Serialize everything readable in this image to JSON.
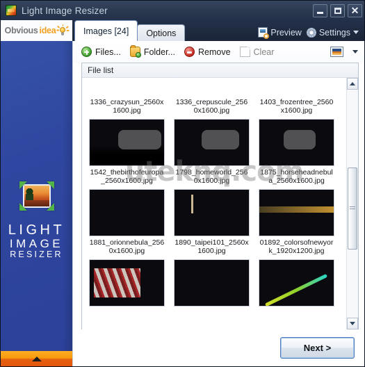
{
  "window": {
    "title": "Light Image Resizer",
    "icon": "app-image-icon",
    "controls": {
      "minimize": "–",
      "maximize": "□",
      "close": "✕"
    }
  },
  "brand": {
    "part1": "Obvious",
    "part2": "idea",
    "icon": "lightbulb-icon"
  },
  "tabs": [
    {
      "label": "Images [24]",
      "active": true
    },
    {
      "label": "Options",
      "active": false
    }
  ],
  "tabbar_right": [
    {
      "label": "Preview",
      "icon": "preview-icon"
    },
    {
      "label": "Settings",
      "icon": "gear-icon"
    }
  ],
  "toolbar": {
    "items": [
      {
        "label": "Files...",
        "icon": "add-files-icon",
        "disabled": false
      },
      {
        "label": "Folder...",
        "icon": "add-folder-icon",
        "disabled": false
      },
      {
        "label": "Remove",
        "icon": "remove-icon",
        "disabled": false
      },
      {
        "label": "Clear",
        "icon": "clear-icon",
        "disabled": true
      }
    ],
    "view_icon": "thumbnail-view-icon",
    "view_caret": "chevron-down-icon"
  },
  "file_list": {
    "header": "File list",
    "rows": [
      {
        "cells": [
          {
            "filename": "1336_crazysun_2560x1600.jpg",
            "art": "t-sun",
            "clipped": true
          },
          {
            "filename": "1336_crepuscule_2560x1600.jpg",
            "art": "t-dusk",
            "clipped": true
          },
          {
            "filename": "1403_frozentree_2560x1600.jpg",
            "art": "t-frozen",
            "clipped": true
          }
        ]
      },
      {
        "cells": [
          {
            "filename": "1542_thebirthofeuropa_2560x1600.jpg",
            "art": "t-moon"
          },
          {
            "filename": "1798_homeworld_2560x1600.jpg",
            "art": "t-planet"
          },
          {
            "filename": "1875_horseheadnebula_2560x1600.jpg",
            "art": "t-nebula-p"
          }
        ]
      },
      {
        "cells": [
          {
            "filename": "1881_orionnebula_2560x1600.jpg",
            "art": "t-orion"
          },
          {
            "filename": "1890_taipei101_2560x1600.jpg",
            "art": "t-taipei"
          },
          {
            "filename": "01892_colorsofnewyork_1920x1200.jpg",
            "art": "t-nyc"
          }
        ]
      },
      {
        "cells": [
          {
            "filename": "",
            "art": "t-bikes"
          },
          {
            "filename": "",
            "art": "t-bw"
          },
          {
            "filename": "",
            "art": "t-wave"
          }
        ]
      }
    ]
  },
  "watermark": "uteknq.com",
  "sidebar": {
    "logo_icon": "resize-photo-icon",
    "word1": "LIGHT",
    "word2": "IMAGE",
    "word3": "RESIZER",
    "footer_icon": "chevron-up-icon"
  },
  "footer": {
    "next_label": "Next >"
  },
  "colors": {
    "accent_blue": "#2c4199",
    "accent_orange": "#f2a01e",
    "titlebar": "#2b394f",
    "footer_orange": "#e2560b"
  }
}
